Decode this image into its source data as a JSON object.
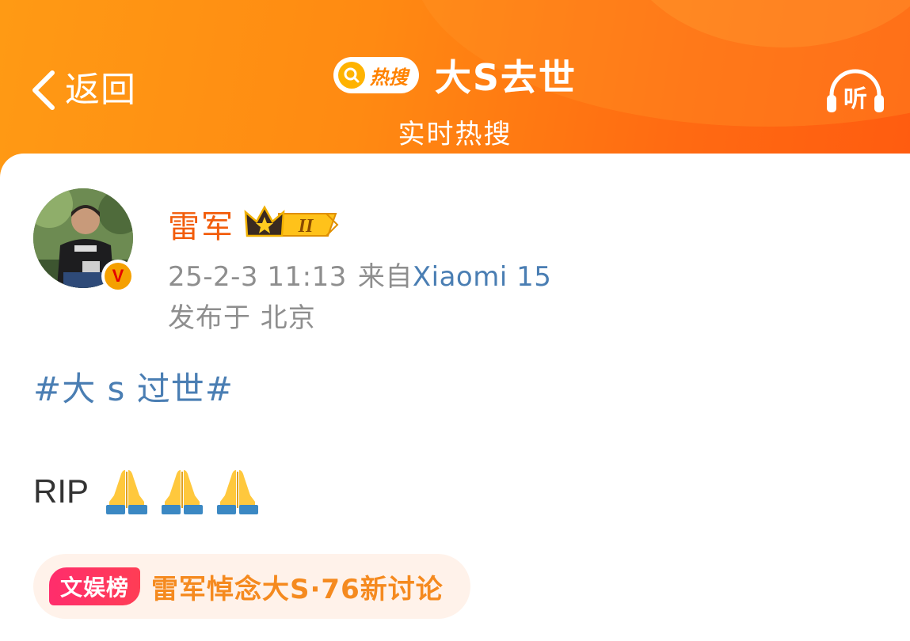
{
  "header": {
    "back_label": "返回",
    "hot_badge_text": "热搜",
    "title": "大S去世",
    "subtitle": "实时热搜",
    "listen_label": "听"
  },
  "post": {
    "author": "雷军",
    "crown_level": "II",
    "verified_mark": "V",
    "timestamp": "25-2-3 11:13",
    "source_prefix": "来自",
    "device": "Xiaomi 15",
    "location": "发布于  北京",
    "hashtag": "#大 s 过世#",
    "body_text": "RIP",
    "emoji_count": 3,
    "emoji_icon": "folded-hands-emoji"
  },
  "topic_tag": {
    "board_label": "文娱榜",
    "text": "雷军悼念大S·76新讨论"
  },
  "colors": {
    "header_orange": "#ff8a12",
    "username_orange": "#f25c0a",
    "link_blue": "#4a7eb3",
    "meta_gray": "#8e8e8e",
    "board_pink": "#ff2d6c",
    "tag_text_orange": "#f58a1f"
  }
}
